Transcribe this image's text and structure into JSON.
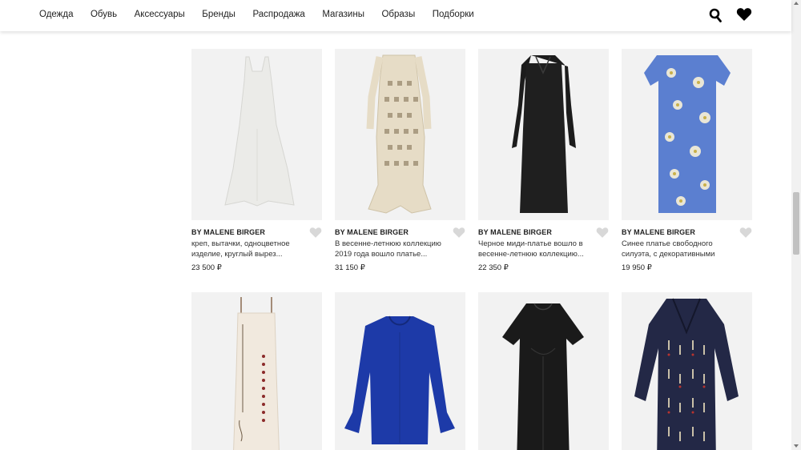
{
  "nav": [
    "Одежда",
    "Обувь",
    "Аксессуары",
    "Бренды",
    "Распродажа",
    "Магазины",
    "Образы",
    "Подборки"
  ],
  "icons": {
    "search": "search-icon",
    "favorites": "heart-icon"
  },
  "products_row1": [
    {
      "brand": "BY MALENE BIRGER",
      "desc": "креп, вытачки, одноцветное изделие, круглый вырез...",
      "price": "23 500 ₽",
      "color": "#efefec"
    },
    {
      "brand": "BY MALENE BIRGER",
      "desc": "В весенне-летнюю коллекцию 2019 года вошло платье...",
      "price": "31 150 ₽",
      "color": "#e6dcc6"
    },
    {
      "brand": "BY MALENE BIRGER",
      "desc": "Черное миди-платье вошло в весенне-летнюю коллекцию...",
      "price": "22 350 ₽",
      "color": "#1c1c1c"
    },
    {
      "brand": "BY MALENE BIRGER",
      "desc": "Синее платье свободного силуэта, с декоративными швам...",
      "price": "19 950 ₽",
      "color": "#5b7fd0"
    }
  ],
  "products_row2": [
    {
      "color": "#f1e9de"
    },
    {
      "color": "#1d3aa8"
    },
    {
      "color": "#1a1a1a"
    },
    {
      "color": "#232846"
    }
  ]
}
